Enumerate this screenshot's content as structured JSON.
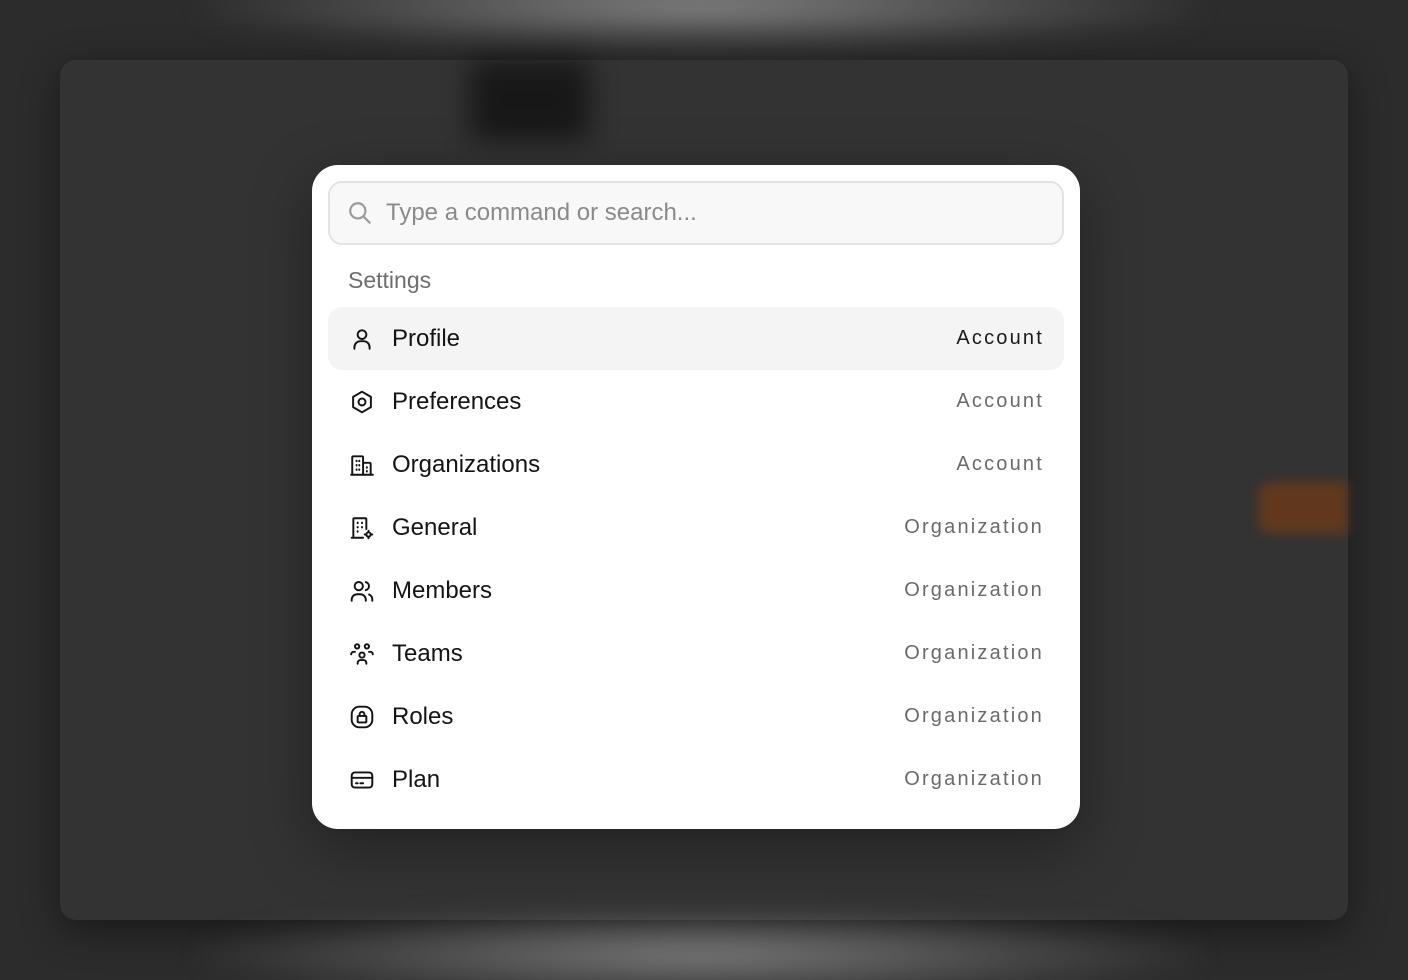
{
  "search": {
    "placeholder": "Type a command or search...",
    "value": ""
  },
  "group": {
    "heading": "Settings"
  },
  "items": [
    {
      "label": "Profile",
      "category": "Account",
      "icon": "user-icon",
      "selected": true
    },
    {
      "label": "Preferences",
      "category": "Account",
      "icon": "hexagon-settings-icon",
      "selected": false
    },
    {
      "label": "Organizations",
      "category": "Account",
      "icon": "buildings-icon",
      "selected": false
    },
    {
      "label": "General",
      "category": "Organization",
      "icon": "building-gear-icon",
      "selected": false
    },
    {
      "label": "Members",
      "category": "Organization",
      "icon": "users-icon",
      "selected": false
    },
    {
      "label": "Teams",
      "category": "Organization",
      "icon": "team-icon",
      "selected": false
    },
    {
      "label": "Roles",
      "category": "Organization",
      "icon": "lock-badge-icon",
      "selected": false
    },
    {
      "label": "Plan",
      "category": "Organization",
      "icon": "credit-card-icon",
      "selected": false
    }
  ],
  "colors": {
    "overlay": "#2c2c2c",
    "panel": "#ffffff",
    "selected_row": "#f4f4f4",
    "text_primary": "#141414",
    "text_secondary": "#6a6a6a"
  }
}
